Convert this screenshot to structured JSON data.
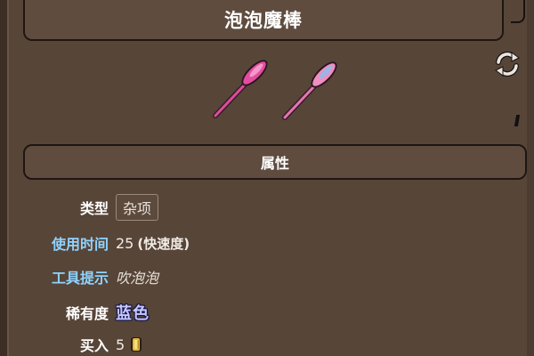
{
  "title": "泡泡魔棒",
  "section_header": "属性",
  "properties": {
    "type": {
      "label": "类型",
      "value": "杂项"
    },
    "use_time": {
      "label": "使用时间",
      "value": "25",
      "suffix": "(快速度)"
    },
    "tooltip": {
      "label": "工具提示",
      "value": "吹泡泡"
    },
    "rarity": {
      "label": "稀有度",
      "value": "蓝色"
    },
    "buy": {
      "label": "买入",
      "value": "5"
    }
  },
  "icons": {
    "refresh": "refresh-icon",
    "coin": "gold-coin-icon",
    "sprite": "bubble-wand-sprite"
  },
  "colors": {
    "background": "#574538",
    "bar": "#5f4c3f",
    "label_blue": "#8fd3ff",
    "rarity_blue": "#c7c7ff",
    "wand_pink": "#e84fa0",
    "wand_light_pink": "#f6a6c8"
  }
}
